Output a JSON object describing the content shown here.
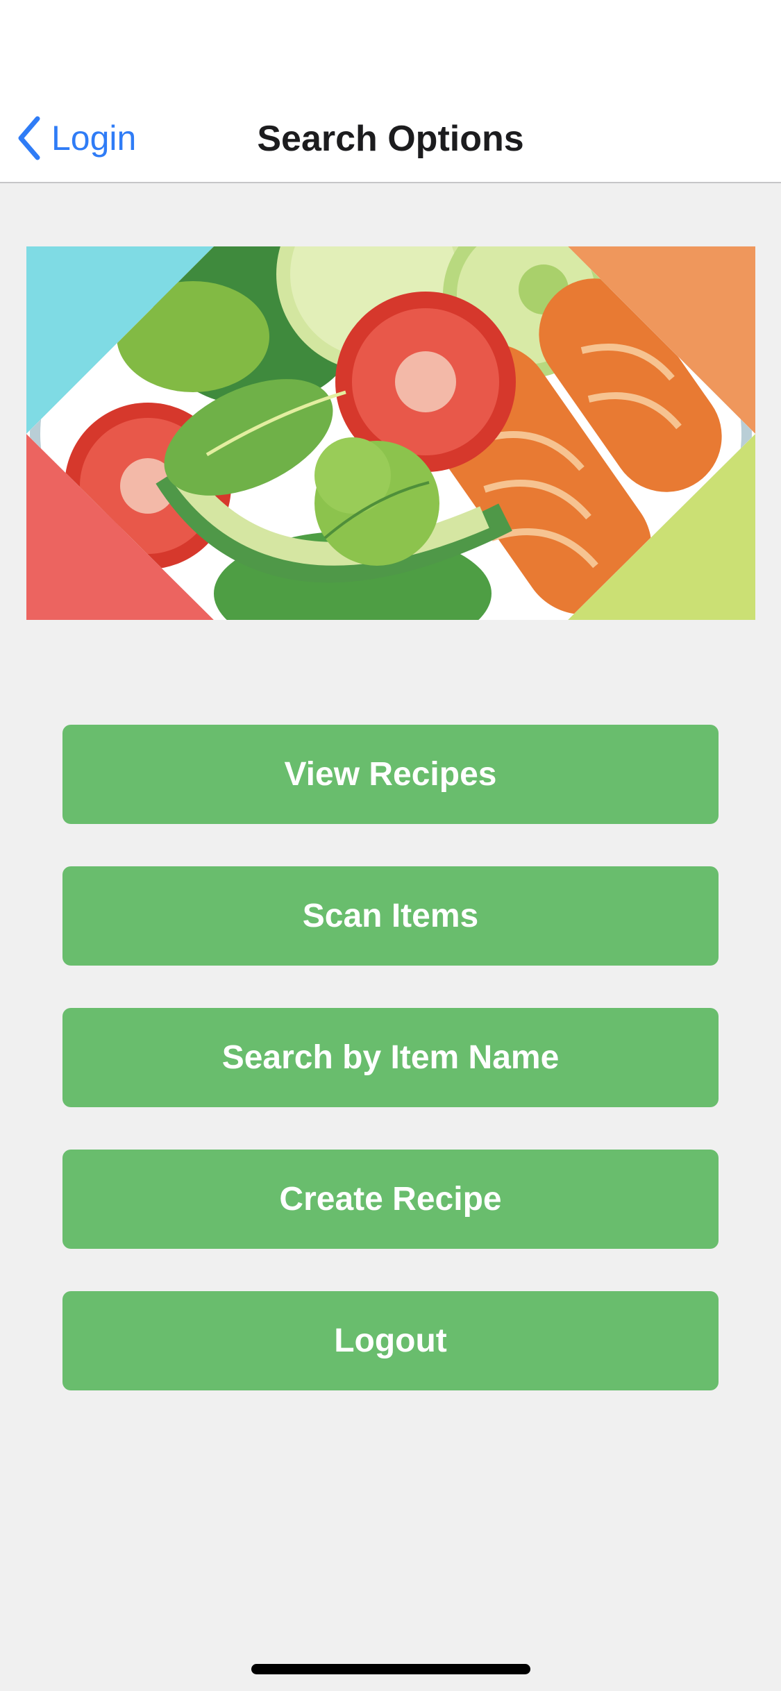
{
  "nav": {
    "back_label": "Login",
    "title": "Search Options",
    "back_icon": "chevron-left-icon",
    "accent_color": "#2f7cf6"
  },
  "banner": {
    "image": "salad-illustration"
  },
  "menu": {
    "button_color": "#69bd6d",
    "buttons": [
      {
        "label": "View Recipes"
      },
      {
        "label": "Scan Items"
      },
      {
        "label": "Search by Item Name"
      },
      {
        "label": "Create Recipe"
      },
      {
        "label": "Logout"
      }
    ]
  }
}
